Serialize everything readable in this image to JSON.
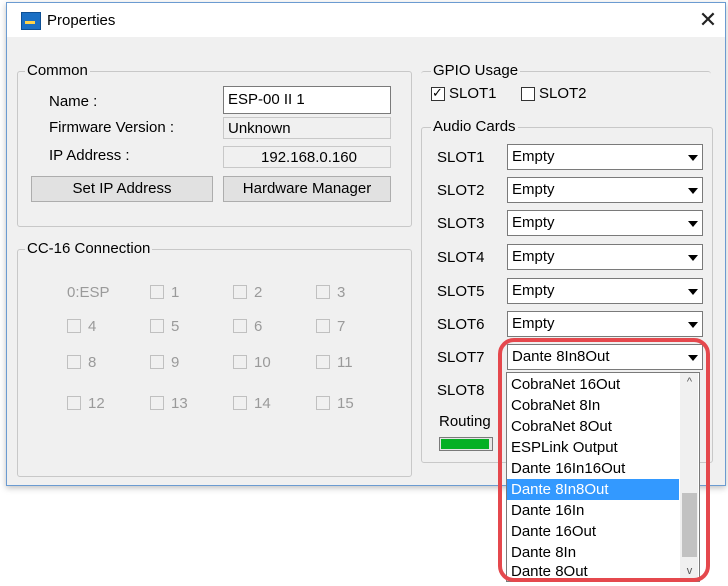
{
  "window": {
    "title": "Properties",
    "close_glyph": "✕"
  },
  "common": {
    "group_label": "Common",
    "name_label": "Name :",
    "name_value": "ESP-00 II 1",
    "firmware_label": "Firmware Version :",
    "firmware_value": "Unknown",
    "ip_label": "IP Address :",
    "ip_value": "192.168.0.160",
    "set_ip_button": "Set IP Address",
    "hw_manager_button": "Hardware Manager"
  },
  "cc16": {
    "group_label": "CC-16 Connection",
    "items": [
      "0:ESP",
      "1",
      "2",
      "3",
      "4",
      "5",
      "6",
      "7",
      "8",
      "9",
      "10",
      "11",
      "12",
      "13",
      "14",
      "15"
    ]
  },
  "gpio": {
    "group_label": "GPIO Usage",
    "slot1_label": "SLOT1",
    "slot1_checked": true,
    "slot2_label": "SLOT2",
    "slot2_checked": false
  },
  "audio_cards": {
    "group_label": "Audio Cards",
    "slots": [
      {
        "label": "SLOT1",
        "value": "Empty"
      },
      {
        "label": "SLOT2",
        "value": "Empty"
      },
      {
        "label": "SLOT3",
        "value": "Empty"
      },
      {
        "label": "SLOT4",
        "value": "Empty"
      },
      {
        "label": "SLOT5",
        "value": "Empty"
      },
      {
        "label": "SLOT6",
        "value": "Empty"
      },
      {
        "label": "SLOT7",
        "value": "Dante 8In8Out"
      },
      {
        "label": "SLOT8",
        "value": ""
      }
    ],
    "routing_label": "Routing",
    "routing_progress_fraction": 0.95
  },
  "dropdown": {
    "options": [
      "CobraNet 16Out",
      "CobraNet 8In",
      "CobraNet 8Out",
      "ESPLink Output",
      "Dante 16In16Out",
      "Dante 8In8Out",
      "Dante 16In",
      "Dante 16Out",
      "Dante 8In",
      "Dante 8Out"
    ],
    "selected": "Dante 8In8Out",
    "scroll_up_glyph": "^",
    "scroll_down_glyph": "v"
  },
  "colors": {
    "selection": "#3399ff",
    "highlight_ring": "#e5484d",
    "progress": "#06b025"
  }
}
